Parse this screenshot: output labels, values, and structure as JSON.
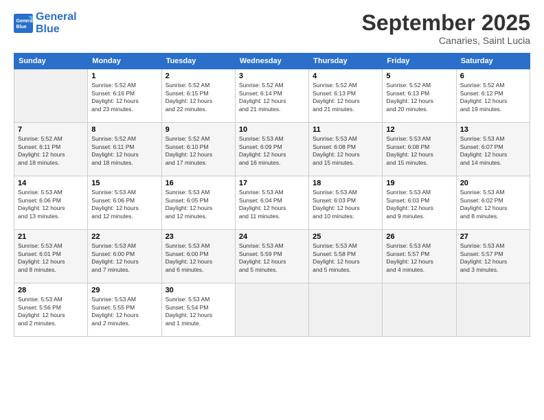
{
  "header": {
    "logo_line1": "General",
    "logo_line2": "Blue",
    "month": "September 2025",
    "location": "Canaries, Saint Lucia"
  },
  "days_of_week": [
    "Sunday",
    "Monday",
    "Tuesday",
    "Wednesday",
    "Thursday",
    "Friday",
    "Saturday"
  ],
  "weeks": [
    [
      {
        "day": "",
        "info": ""
      },
      {
        "day": "1",
        "info": "Sunrise: 5:52 AM\nSunset: 6:16 PM\nDaylight: 12 hours\nand 23 minutes."
      },
      {
        "day": "2",
        "info": "Sunrise: 5:52 AM\nSunset: 6:15 PM\nDaylight: 12 hours\nand 22 minutes."
      },
      {
        "day": "3",
        "info": "Sunrise: 5:52 AM\nSunset: 6:14 PM\nDaylight: 12 hours\nand 21 minutes."
      },
      {
        "day": "4",
        "info": "Sunrise: 5:52 AM\nSunset: 6:13 PM\nDaylight: 12 hours\nand 21 minutes."
      },
      {
        "day": "5",
        "info": "Sunrise: 5:52 AM\nSunset: 6:13 PM\nDaylight: 12 hours\nand 20 minutes."
      },
      {
        "day": "6",
        "info": "Sunrise: 5:52 AM\nSunset: 6:12 PM\nDaylight: 12 hours\nand 19 minutes."
      }
    ],
    [
      {
        "day": "7",
        "info": "Sunrise: 5:52 AM\nSunset: 6:11 PM\nDaylight: 12 hours\nand 18 minutes."
      },
      {
        "day": "8",
        "info": "Sunrise: 5:52 AM\nSunset: 6:11 PM\nDaylight: 12 hours\nand 18 minutes."
      },
      {
        "day": "9",
        "info": "Sunrise: 5:52 AM\nSunset: 6:10 PM\nDaylight: 12 hours\nand 17 minutes."
      },
      {
        "day": "10",
        "info": "Sunrise: 5:53 AM\nSunset: 6:09 PM\nDaylight: 12 hours\nand 16 minutes."
      },
      {
        "day": "11",
        "info": "Sunrise: 5:53 AM\nSunset: 6:08 PM\nDaylight: 12 hours\nand 15 minutes."
      },
      {
        "day": "12",
        "info": "Sunrise: 5:53 AM\nSunset: 6:08 PM\nDaylight: 12 hours\nand 15 minutes."
      },
      {
        "day": "13",
        "info": "Sunrise: 5:53 AM\nSunset: 6:07 PM\nDaylight: 12 hours\nand 14 minutes."
      }
    ],
    [
      {
        "day": "14",
        "info": "Sunrise: 5:53 AM\nSunset: 6:06 PM\nDaylight: 12 hours\nand 13 minutes."
      },
      {
        "day": "15",
        "info": "Sunrise: 5:53 AM\nSunset: 6:06 PM\nDaylight: 12 hours\nand 12 minutes."
      },
      {
        "day": "16",
        "info": "Sunrise: 5:53 AM\nSunset: 6:05 PM\nDaylight: 12 hours\nand 12 minutes."
      },
      {
        "day": "17",
        "info": "Sunrise: 5:53 AM\nSunset: 6:04 PM\nDaylight: 12 hours\nand 11 minutes."
      },
      {
        "day": "18",
        "info": "Sunrise: 5:53 AM\nSunset: 6:03 PM\nDaylight: 12 hours\nand 10 minutes."
      },
      {
        "day": "19",
        "info": "Sunrise: 5:53 AM\nSunset: 6:03 PM\nDaylight: 12 hours\nand 9 minutes."
      },
      {
        "day": "20",
        "info": "Sunrise: 5:53 AM\nSunset: 6:02 PM\nDaylight: 12 hours\nand 8 minutes."
      }
    ],
    [
      {
        "day": "21",
        "info": "Sunrise: 5:53 AM\nSunset: 6:01 PM\nDaylight: 12 hours\nand 8 minutes."
      },
      {
        "day": "22",
        "info": "Sunrise: 5:53 AM\nSunset: 6:00 PM\nDaylight: 12 hours\nand 7 minutes."
      },
      {
        "day": "23",
        "info": "Sunrise: 5:53 AM\nSunset: 6:00 PM\nDaylight: 12 hours\nand 6 minutes."
      },
      {
        "day": "24",
        "info": "Sunrise: 5:53 AM\nSunset: 5:59 PM\nDaylight: 12 hours\nand 5 minutes."
      },
      {
        "day": "25",
        "info": "Sunrise: 5:53 AM\nSunset: 5:58 PM\nDaylight: 12 hours\nand 5 minutes."
      },
      {
        "day": "26",
        "info": "Sunrise: 5:53 AM\nSunset: 5:57 PM\nDaylight: 12 hours\nand 4 minutes."
      },
      {
        "day": "27",
        "info": "Sunrise: 5:53 AM\nSunset: 5:57 PM\nDaylight: 12 hours\nand 3 minutes."
      }
    ],
    [
      {
        "day": "28",
        "info": "Sunrise: 5:53 AM\nSunset: 5:56 PM\nDaylight: 12 hours\nand 2 minutes."
      },
      {
        "day": "29",
        "info": "Sunrise: 5:53 AM\nSunset: 5:55 PM\nDaylight: 12 hours\nand 2 minutes."
      },
      {
        "day": "30",
        "info": "Sunrise: 5:53 AM\nSunset: 5:54 PM\nDaylight: 12 hours\nand 1 minute."
      },
      {
        "day": "",
        "info": ""
      },
      {
        "day": "",
        "info": ""
      },
      {
        "day": "",
        "info": ""
      },
      {
        "day": "",
        "info": ""
      }
    ]
  ]
}
